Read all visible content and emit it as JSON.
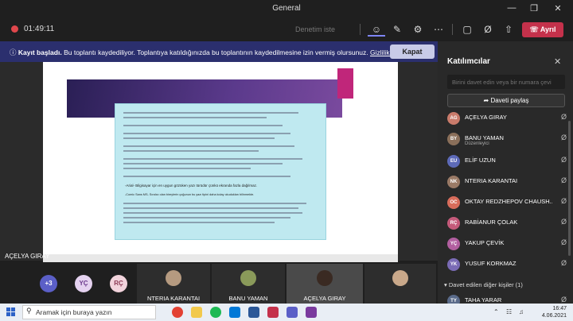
{
  "window": {
    "title": "General"
  },
  "toolbar": {
    "timer": "01:49:11",
    "disabled_label": "Denetim iste",
    "leave_label": "Ayrıl"
  },
  "banner": {
    "bold": "Kayıt başladı.",
    "text": "Bu toplantı kaydediliyor. Toplantıya katıldığınızda bu toplantının kaydedilmesine izin vermiş olursunuz.",
    "link": "Gizlilik ilkesi",
    "close_label": "Kapat"
  },
  "slide": {
    "bullet_bold_1": "-Arial- Bilgisayar için en uygun gözüken yazı türüdür çünkü ekranda fazla dağılmaz.",
    "bullet_bold_2": "-Comic Sans MS- Sıralıcı olan bireylerin çoğunun bu yazı tipini daha kolay okudukları bilinmekte."
  },
  "self": {
    "name": "AÇELYA GIRAY"
  },
  "strip": {
    "overflow": "+3",
    "initials": [
      "YÇ",
      "RÇ"
    ],
    "tiles": [
      "NTERIA KARANTAI",
      "BANU YAMAN",
      "AÇELYA GIRAY"
    ]
  },
  "panel": {
    "title": "Katılımcılar",
    "invite_placeholder": "Birini davet edin veya bir numara çevi",
    "share_label": "Daveti paylaş",
    "participants": [
      {
        "initials": "AG",
        "name": "AÇELYA GIRAY",
        "role": "",
        "color": "#c97b6b"
      },
      {
        "initials": "BY",
        "name": "BANU YAMAN",
        "role": "Düzenleyici",
        "color": "#8a6f5a"
      },
      {
        "initials": "EU",
        "name": "ELİF UZUN",
        "role": "",
        "color": "#5d6ab8"
      },
      {
        "initials": "NK",
        "name": "NTERIA KARANTAI",
        "role": "",
        "color": "#9a7a66"
      },
      {
        "initials": "OC",
        "name": "OKTAY REDZHEPOV CHAUSH...",
        "role": "",
        "color": "#d86c5b"
      },
      {
        "initials": "RÇ",
        "name": "RABİANUR ÇOLAK",
        "role": "",
        "color": "#c45a7a"
      },
      {
        "initials": "YÇ",
        "name": "YAKUP ÇEVİK",
        "role": "",
        "color": "#b25fa0"
      },
      {
        "initials": "YK",
        "name": "YUSUF KORKMAZ",
        "role": "",
        "color": "#7a6bb5"
      }
    ],
    "section_label": "Davet edilen diğer kişiler (1)",
    "invited": {
      "initials": "TY",
      "name": "TAHA YARAR",
      "role": "Yanıt yok",
      "color": "#5a6b8a"
    }
  },
  "taskbar": {
    "search_placeholder": "Aramak için buraya yazın",
    "time": "16:47",
    "date": "4.06.2021"
  }
}
